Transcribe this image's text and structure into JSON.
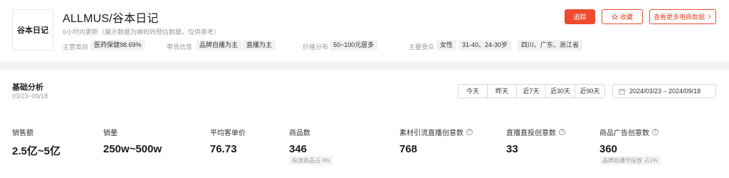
{
  "shop": {
    "logo_text": "谷本日记",
    "title": "ALLMUS/谷本日记",
    "update_note": "6小时内更新（展示数据为蝉妈妈预估数据，仅供参考）"
  },
  "meta": {
    "category_label": "主营类目",
    "category_value": "医药保健98.69%",
    "delivery_label": "带货信息",
    "delivery_tags": [
      "品牌自播为主",
      "直播为主"
    ],
    "price_label": "价格分布",
    "price_value": "50~100元居多",
    "audience_label": "主要受众",
    "audience_tags": [
      "女性",
      "31-40、24-30岁",
      "四川、广东、浙江省"
    ]
  },
  "actions": {
    "track": "追踪",
    "favorite": "收藏",
    "more": "查看更多电商数据"
  },
  "analysis": {
    "title": "基础分析",
    "date": "03/23~09/18",
    "ranges": [
      "今天",
      "昨天",
      "近7天",
      "近30天",
      "近90天"
    ],
    "date_range": "2024/03/23 – 2024/09/18"
  },
  "metrics": [
    {
      "label": "销售额",
      "value": "2.5亿~5亿"
    },
    {
      "label": "销量",
      "value": "250w~500w"
    },
    {
      "label": "平均客单价",
      "value": "76.73"
    },
    {
      "label": "商品数",
      "value": "346",
      "sub": "投流商品占 4%"
    },
    {
      "label": "素材引流直播创意数",
      "value": "768"
    },
    {
      "label": "直播直投创意数",
      "value": "33"
    },
    {
      "label": "商品广告创意数",
      "value": "360",
      "sub": "品牌自播号投放 占1%"
    }
  ],
  "colors": {
    "accent": "#ee4a2e"
  }
}
